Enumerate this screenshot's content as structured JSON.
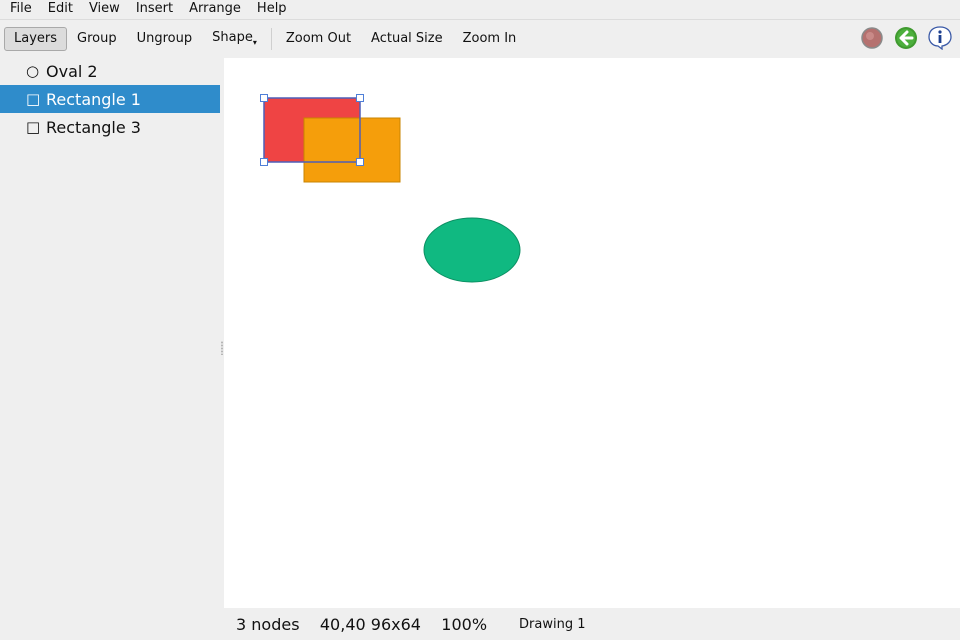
{
  "menu": [
    "File",
    "Edit",
    "View",
    "Insert",
    "Arrange",
    "Help"
  ],
  "toolbar": {
    "layers": "Layers",
    "group": "Group",
    "ungroup": "Ungroup",
    "shape": "Shape",
    "zoom_out": "Zoom Out",
    "actual_size": "Actual Size",
    "zoom_in": "Zoom In",
    "icons": [
      "record-icon",
      "back-arrow-icon",
      "info-icon"
    ]
  },
  "layers": [
    {
      "glyph": "○",
      "label": "Oval 2",
      "selected": false
    },
    {
      "glyph": "□",
      "label": "Rectangle 1",
      "selected": true
    },
    {
      "glyph": "□",
      "label": "Rectangle 3",
      "selected": false
    }
  ],
  "shapes": {
    "rect1_color": "#ef4444",
    "rect3_color": "#f59e0b",
    "oval_color": "#10b981",
    "selection_color": "#4f5fb8"
  },
  "status": {
    "text": "3 nodes    40,40 96x64    100%",
    "document": "Drawing 1"
  }
}
